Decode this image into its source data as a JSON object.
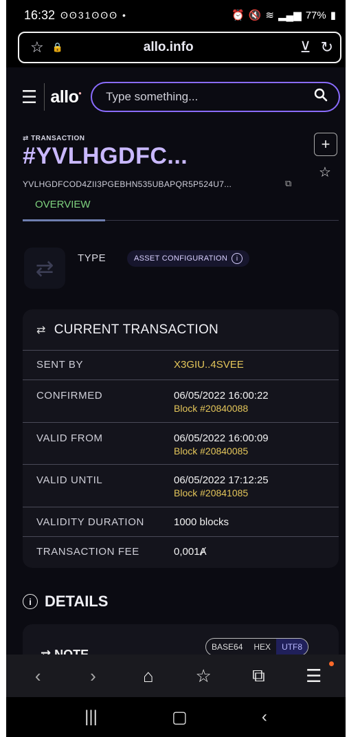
{
  "status_bar": {
    "time": "16:32",
    "notif_icons": "ʘʘ31ʘʘʘ •",
    "battery": "77%"
  },
  "browser": {
    "url": "allo.info"
  },
  "site": {
    "logo": "allo",
    "search_placeholder": "Type something..."
  },
  "transaction": {
    "label": "TRANSACTION",
    "title": "#YVLHGDFC...",
    "hash": "YVLHGDFCOD4ZII3PGEBHN535UBAPQR5P524U7...",
    "tab_overview": "OVERVIEW",
    "type_label": "TYPE",
    "type_value": "ASSET CONFIGURATION"
  },
  "current_transaction": {
    "title": "CURRENT TRANSACTION",
    "rows": [
      {
        "key": "SENT BY",
        "value": "X3GIU..4SVEE"
      },
      {
        "key": "CONFIRMED",
        "value": "06/05/2022   16:00:22",
        "block": "Block #20840088"
      },
      {
        "key": "VALID FROM",
        "value": "06/05/2022   16:00:09",
        "block": "Block #20840085"
      },
      {
        "key": "VALID UNTIL",
        "value": "06/05/2022   17:12:25",
        "block": "Block #20841085"
      },
      {
        "key": "VALIDITY DURATION",
        "value": "1000 blocks"
      },
      {
        "key": "TRANSACTION FEE",
        "value": "0,001Ⱥ"
      }
    ]
  },
  "details": {
    "title": "DETAILS",
    "note_label": "NOTE",
    "formats": [
      "BASE64",
      "HEX",
      "UTF8"
    ],
    "active_format": "UTF8"
  },
  "colors": {
    "accent_purple": "#c9b8ff",
    "block_yellow": "#e4c65a",
    "overview_green": "#7fd37f"
  }
}
